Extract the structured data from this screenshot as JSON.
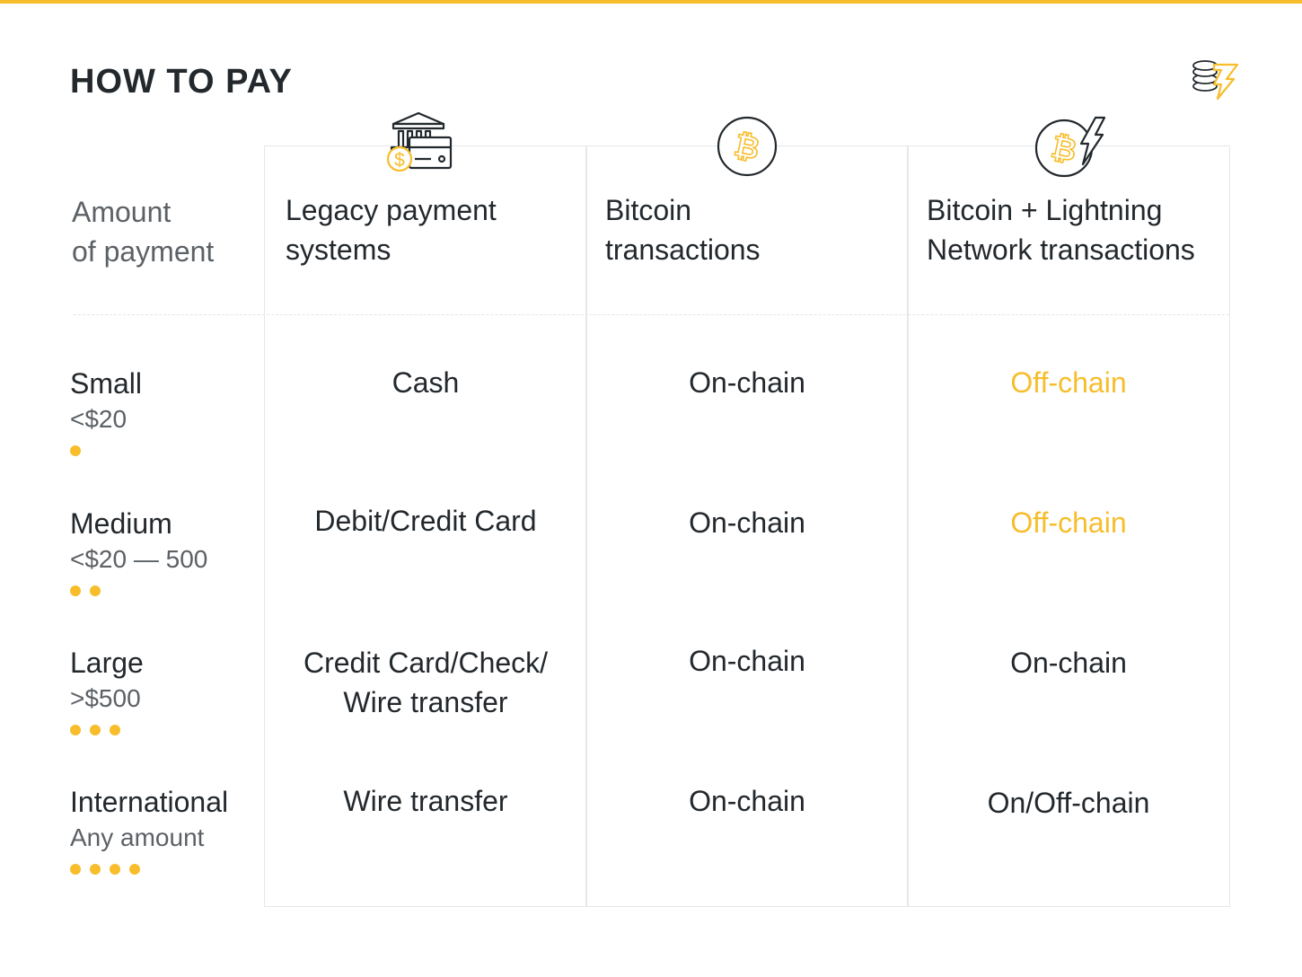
{
  "title": "HOW TO PAY",
  "colors": {
    "accent": "#f7bd2b",
    "text": "#23282d",
    "muted": "#5c6166",
    "border": "#e6e7e9"
  },
  "icons": {
    "logo": "coins-lightning-logo-icon",
    "legacy": "bank-card-coin-icon",
    "bitcoin": "bitcoin-icon",
    "lightning": "bitcoin-lightning-icon"
  },
  "row_header": "Amount\nof payment",
  "columns": [
    {
      "label": "Legacy payment\nsystems"
    },
    {
      "label": "Bitcoin\ntransactions"
    },
    {
      "label": "Bitcoin + Lightning\nNetwork transactions"
    }
  ],
  "rows": [
    {
      "name": "Small",
      "range": "<$20",
      "dots": 1,
      "cells": [
        {
          "text": "Cash",
          "highlight": false
        },
        {
          "text": "On-chain",
          "highlight": false
        },
        {
          "text": "Off-chain",
          "highlight": true
        }
      ]
    },
    {
      "name": "Medium",
      "range": "<$20 — 500",
      "dots": 2,
      "cells": [
        {
          "text": "Debit/Credit Card",
          "highlight": false
        },
        {
          "text": "On-chain",
          "highlight": false
        },
        {
          "text": "Off-chain",
          "highlight": true
        }
      ]
    },
    {
      "name": "Large",
      "range": ">$500",
      "dots": 3,
      "cells": [
        {
          "text": "Credit Card/Check/\nWire transfer",
          "highlight": false
        },
        {
          "text": "On-chain",
          "highlight": false
        },
        {
          "text": "On-chain",
          "highlight": false
        }
      ]
    },
    {
      "name": "International",
      "range": "Any amount",
      "dots": 4,
      "cells": [
        {
          "text": "Wire transfer",
          "highlight": false
        },
        {
          "text": "On-chain",
          "highlight": false
        },
        {
          "text": "On/Off-chain",
          "highlight": false
        }
      ]
    }
  ]
}
